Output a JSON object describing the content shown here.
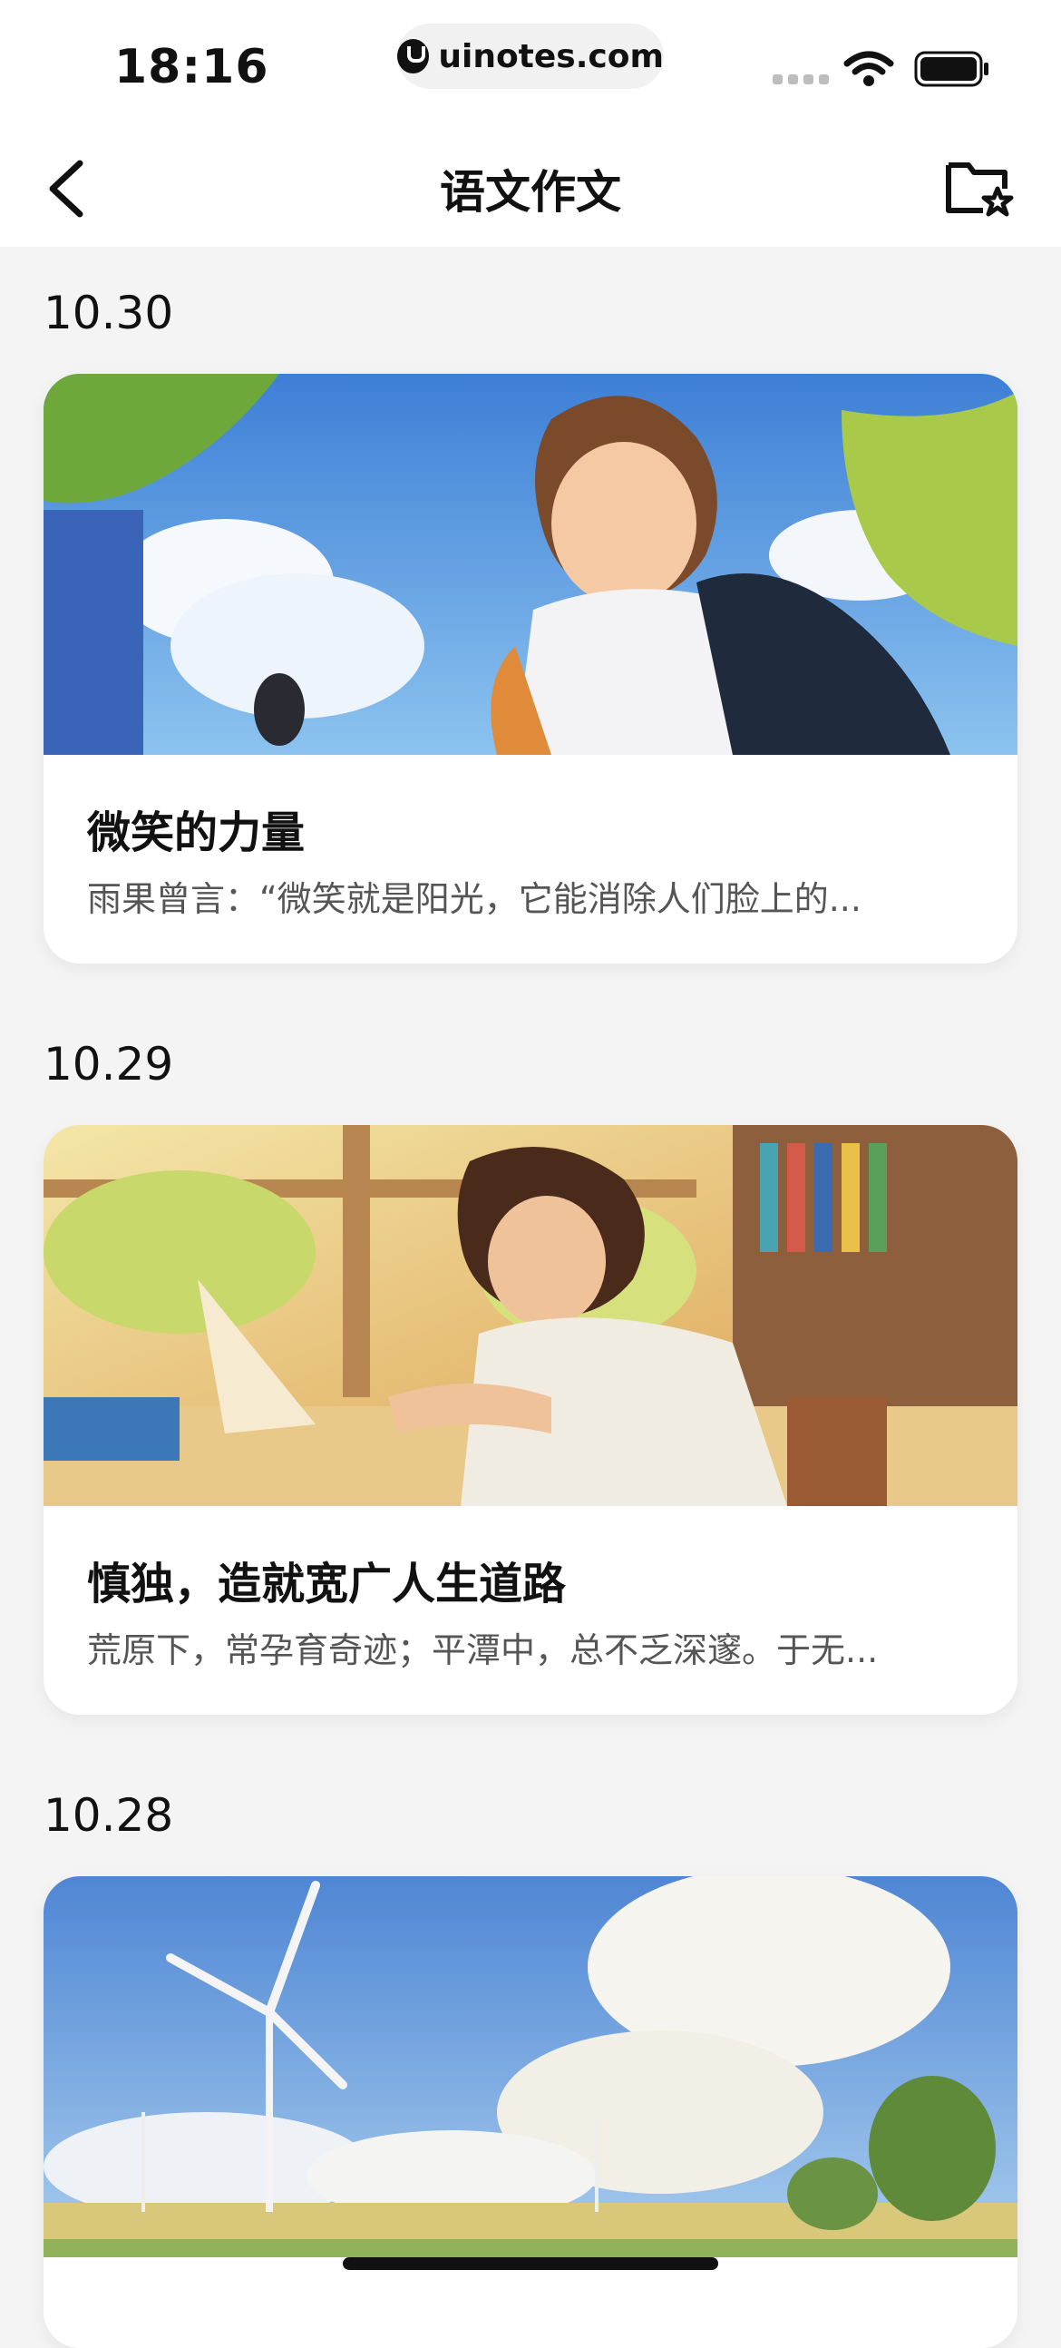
{
  "status_bar": {
    "time": "18:16",
    "url": "uinotes.com"
  },
  "nav": {
    "title": "语文作文",
    "back_icon": "chevron-left-icon",
    "favorites_icon": "folder-star-icon"
  },
  "entries": [
    {
      "date": "10.30",
      "title": "微笑的力量",
      "excerpt": "雨果曾言：“微笑就是阳光，它能消除人们脸上的..."
    },
    {
      "date": "10.29",
      "title": "慎独，造就宽广人生道路",
      "excerpt": "荒原下，常孕育奇迹；平潭中，总不乏深邃。于无..."
    },
    {
      "date": "10.28"
    }
  ]
}
